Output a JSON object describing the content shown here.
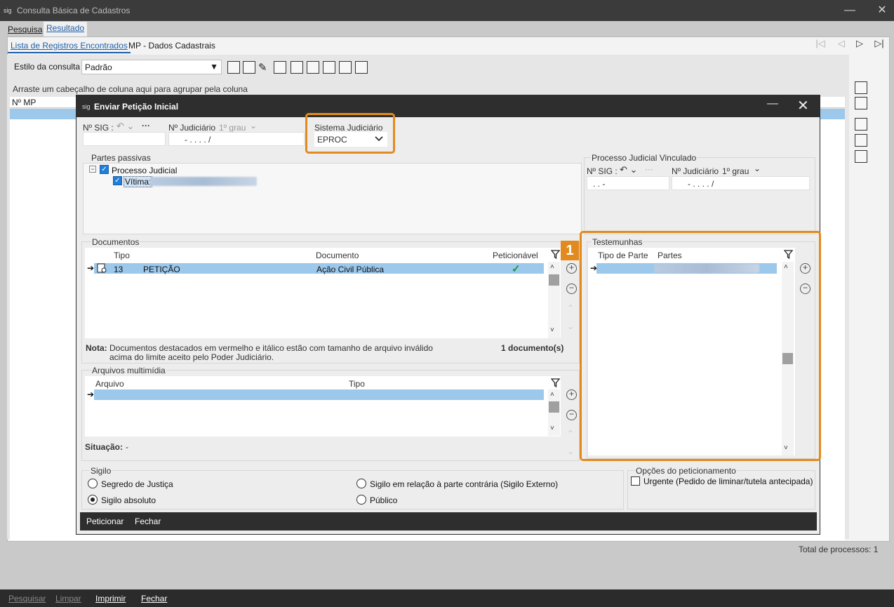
{
  "window": {
    "title": "Consulta Básica de Cadastros",
    "minimize": "—",
    "close": "✕"
  },
  "top_tabs": [
    "Pesquisa",
    "Resultado"
  ],
  "sub_tabs": [
    "Lista de Registros Encontrados",
    "MP - Dados Cadastrais"
  ],
  "nav_buttons": [
    "|◁",
    "◁",
    "▷",
    "▷|"
  ],
  "estilo": {
    "label": "Estilo da consulta",
    "value": "Padrão"
  },
  "group_bar": "Arraste um cabeçalho de coluna aqui para agrupar pela coluna",
  "grid": {
    "column": "Nº MP"
  },
  "total": "Total de processos: 1",
  "bottom_bar": [
    "Pesquisar",
    "Limpar",
    "Imprimir",
    "Fechar"
  ],
  "dialog": {
    "title": "Enviar Petição Inicial",
    "sig_label": "Nº SIG :",
    "judicial_label": "Nº Judiciário",
    "grau": "1º grau",
    "judicial_mask": "- .  . . .   /",
    "sistema_label": "Sistema Judiciário",
    "sistema_value": "EPROC",
    "partes_label": "Partes passivas",
    "tree_root": "Processo Judicial",
    "tree_child": "Vítima:",
    "vinculado_label": "Processo Judicial Vinculado",
    "vinc_sig_mask": ".  .     -",
    "vinc_jud_mask": "- .  . . .   /",
    "documentos": {
      "label": "Documentos",
      "headers": [
        "Tipo",
        "Documento",
        "Peticionável"
      ],
      "rows": [
        {
          "code": "13",
          "tipo": "PETIÇÃO",
          "documento": "Ação Civil Pública",
          "peticionavel": "✓"
        }
      ],
      "nota_label": "Nota:",
      "nota_text": "Documentos destacados em vermelho e itálico estão com tamanho de arquivo inválido",
      "nota_text2": "acima do limite aceito pelo Poder Judiciário.",
      "count": "1 documento(s)"
    },
    "multimidia": {
      "label": "Arquivos multimídia",
      "headers": [
        "Arquivo",
        "Tipo"
      ]
    },
    "situacao_label": "Situação:",
    "situacao_value": "-",
    "testemunhas": {
      "label": "Testemunhas",
      "headers": [
        "Tipo de Parte",
        "Partes"
      ]
    },
    "badge": "1",
    "sigilo": {
      "label": "Sigilo",
      "options": [
        "Segredo de Justiça",
        "Sigilo absoluto",
        "Sigilo em relação à parte contrária (Sigilo Externo)",
        "Público"
      ],
      "selected": "Sigilo absoluto"
    },
    "opcoes": {
      "label": "Opções do peticionamento",
      "urgente": "Urgente (Pedido de liminar/tutela antecipada)"
    },
    "footer": [
      "Peticionar",
      "Fechar"
    ]
  }
}
